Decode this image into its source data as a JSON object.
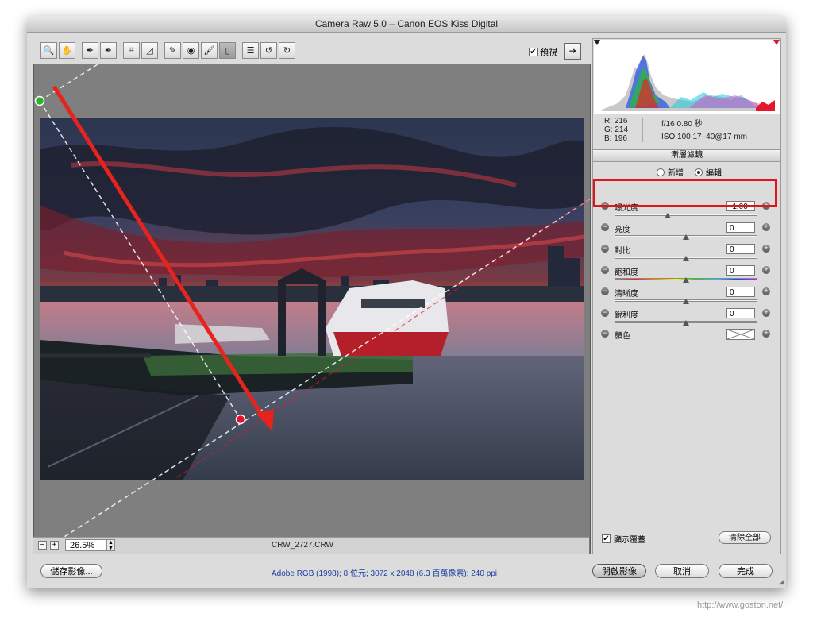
{
  "window": {
    "title": "Camera Raw 5.0  –  Canon EOS Kiss Digital"
  },
  "toolbar": {
    "tools": [
      {
        "name": "zoom-tool",
        "icon": "magnifier-icon",
        "glyph": "🔍"
      },
      {
        "name": "hand-tool",
        "icon": "hand-icon",
        "glyph": "✋"
      },
      {
        "name": "white-balance-tool",
        "icon": "eyedropper-icon",
        "glyph": "✒"
      },
      {
        "name": "color-sampler-tool",
        "icon": "color-sampler-icon",
        "glyph": "✒"
      },
      {
        "name": "crop-tool",
        "icon": "crop-icon",
        "glyph": "⌗"
      },
      {
        "name": "straighten-tool",
        "icon": "straighten-icon",
        "glyph": "◿"
      },
      {
        "name": "spot-removal-tool",
        "icon": "spot-removal-icon",
        "glyph": "✎"
      },
      {
        "name": "red-eye-tool",
        "icon": "red-eye-icon",
        "glyph": "◉"
      },
      {
        "name": "adjustment-brush-tool",
        "icon": "brush-icon",
        "glyph": "🖌"
      },
      {
        "name": "graduated-filter-tool",
        "icon": "graduated-filter-icon",
        "glyph": "▯"
      },
      {
        "name": "preferences-tool",
        "icon": "list-icon",
        "glyph": "☰"
      },
      {
        "name": "rotate-left-tool",
        "icon": "rotate-left-icon",
        "glyph": "↺"
      },
      {
        "name": "rotate-right-tool",
        "icon": "rotate-right-icon",
        "glyph": "↻"
      }
    ],
    "preview_label": "預視",
    "preview_checked": "✔"
  },
  "canvas": {
    "filename": "CRW_2727.CRW",
    "zoom": "26.5%",
    "zoom_out": "−",
    "zoom_in": "+"
  },
  "info": {
    "r": "R:  216",
    "g": "G:  214",
    "b": "B:  196",
    "aperture_shutter": "f/16   0.80 秒",
    "iso_lens": "ISO 100   17–40@17 mm"
  },
  "panel": {
    "title": "漸層濾鏡",
    "mode_new": "新增",
    "mode_edit": "編輯",
    "sliders": [
      {
        "label": "曝光度",
        "value": "-1.00",
        "thumb_position": 0.37
      },
      {
        "label": "亮度",
        "value": "0",
        "thumb_position": 0.5
      },
      {
        "label": "對比",
        "value": "0",
        "thumb_position": 0.5
      },
      {
        "label": "飽和度",
        "value": "0",
        "thumb_position": 0.5
      },
      {
        "label": "清晰度",
        "value": "0",
        "thumb_position": 0.5
      },
      {
        "label": "銳利度",
        "value": "0",
        "thumb_position": 0.5
      }
    ],
    "color_label": "顏色",
    "minus": "−",
    "plus": "+",
    "show_overlay": "顯示覆蓋",
    "show_overlay_checked": "✔",
    "clear_all": "清除全部"
  },
  "footer": {
    "save": "儲存影像...",
    "workflow": "Adobe RGB (1998); 8 位元; 3072 x 2048 (6.3 百萬像素); 240 ppi",
    "open": "開啟影像",
    "cancel": "取消",
    "done": "完成"
  },
  "watermark": "http://www.goston.net/",
  "colors": {
    "highlight": "#e0141b",
    "arrow": "#e8231e",
    "start_pin": "#2bb12b",
    "end_pin": "#e0142a"
  }
}
